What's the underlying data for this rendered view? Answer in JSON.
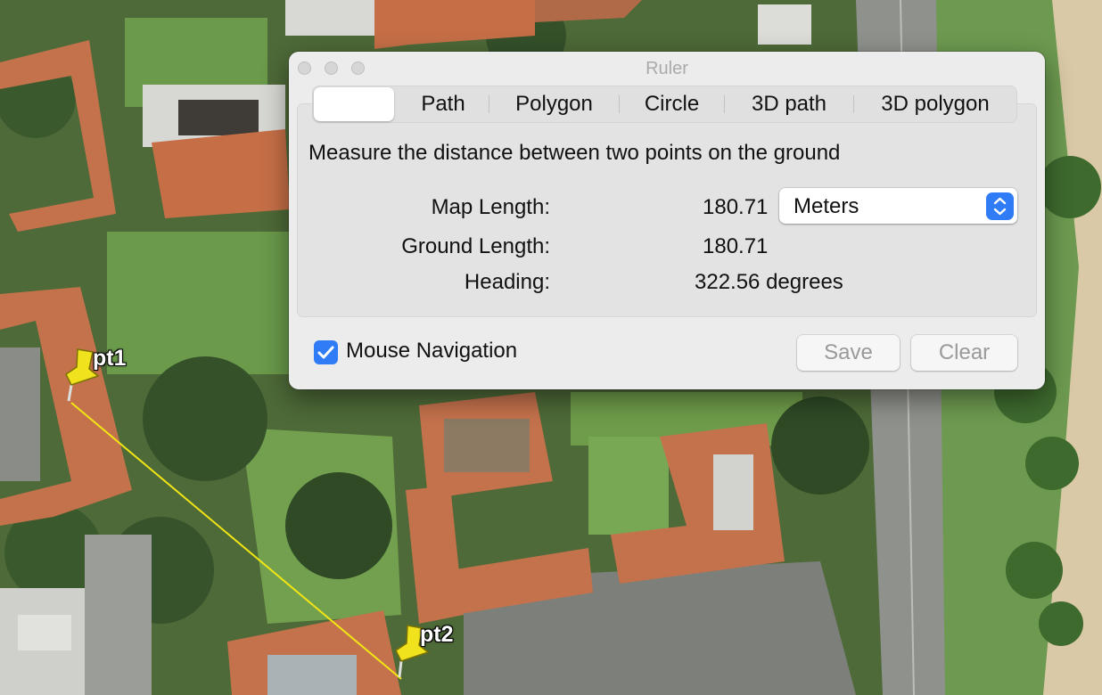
{
  "window": {
    "title": "Ruler"
  },
  "tabs": [
    {
      "label": "",
      "selected": true
    },
    {
      "label": "Path",
      "selected": false
    },
    {
      "label": "Polygon",
      "selected": false
    },
    {
      "label": "Circle",
      "selected": false
    },
    {
      "label": "3D path",
      "selected": false
    },
    {
      "label": "3D polygon",
      "selected": false
    }
  ],
  "description": "Measure the distance between two points on the ground",
  "measurements": {
    "map_length_label": "Map Length:",
    "map_length_value": "180.71",
    "ground_length_label": "Ground Length:",
    "ground_length_value": "180.71",
    "heading_label": "Heading:",
    "heading_value": "322.56 degrees"
  },
  "units_select": {
    "selected": "Meters"
  },
  "mouse_navigation": {
    "label": "Mouse Navigation",
    "checked": true
  },
  "buttons": {
    "save": "Save",
    "clear": "Clear"
  },
  "map": {
    "pins": [
      {
        "label": "pt1"
      },
      {
        "label": "pt2"
      }
    ],
    "line_color": "#f2e614",
    "pin_color": "#f0e21c"
  },
  "colors": {
    "accent": "#2f7cf6",
    "roof": "#c8714a",
    "grass": "#5b8a3c"
  }
}
